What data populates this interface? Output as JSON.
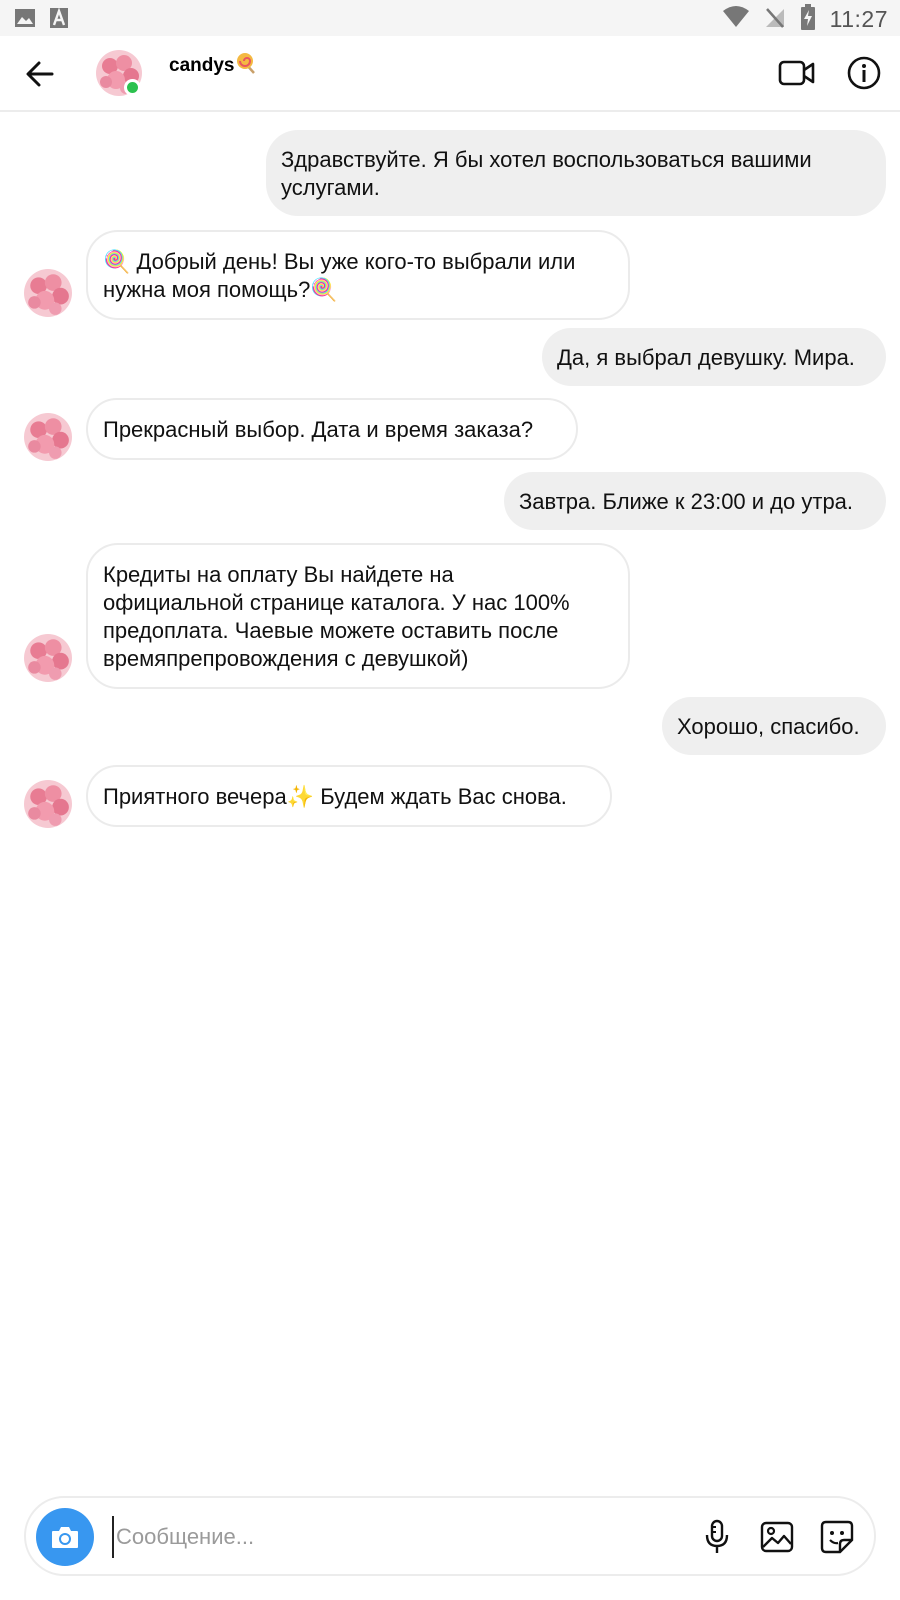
{
  "status_bar": {
    "time": "11:27",
    "icons": [
      "image-icon",
      "a-font-icon",
      "wifi-icon",
      "no-signal-icon",
      "battery-charging-icon"
    ]
  },
  "header": {
    "contact_name": "candys",
    "contact_name_emoji": "lollipop-icon",
    "online": true,
    "icons": [
      "back-arrow-icon",
      "video-call-icon",
      "info-icon"
    ]
  },
  "messages": [
    {
      "direction": "out",
      "text": "Здравствуйте. Я бы хотел воспользоваться вашими\nуслугами."
    },
    {
      "direction": "in",
      "text": "🍭 Добрый день! Вы уже кого-то выбрали или\nнужна моя помощь?🍭"
    },
    {
      "direction": "out",
      "text": "Да, я выбрал девушку. Мира."
    },
    {
      "direction": "in",
      "text": "Прекрасный выбор. Дата и время заказа?"
    },
    {
      "direction": "out",
      "text": "Завтра. Ближе к 23:00 и до утра."
    },
    {
      "direction": "in",
      "text": "Кредиты на оплату Вы найдете на\nофициальной странице каталога. У нас 100%\nпредоплата. Чаевые можете оставить после\nвремяпрепровождения с девушкой)"
    },
    {
      "direction": "out",
      "text": "Хорошо, спасибо."
    },
    {
      "direction": "in",
      "text": "Приятного вечера✨ Будем ждать Вас снова."
    }
  ],
  "composer": {
    "placeholder": "Сообщение...",
    "value": "",
    "icons": [
      "camera-icon",
      "microphone-icon",
      "gallery-icon",
      "sticker-icon"
    ]
  },
  "colors": {
    "accent_blue": "#3897f0",
    "online_green": "#2bc14e",
    "outgoing_bubble": "#efefef",
    "incoming_border": "#ebebeb"
  }
}
